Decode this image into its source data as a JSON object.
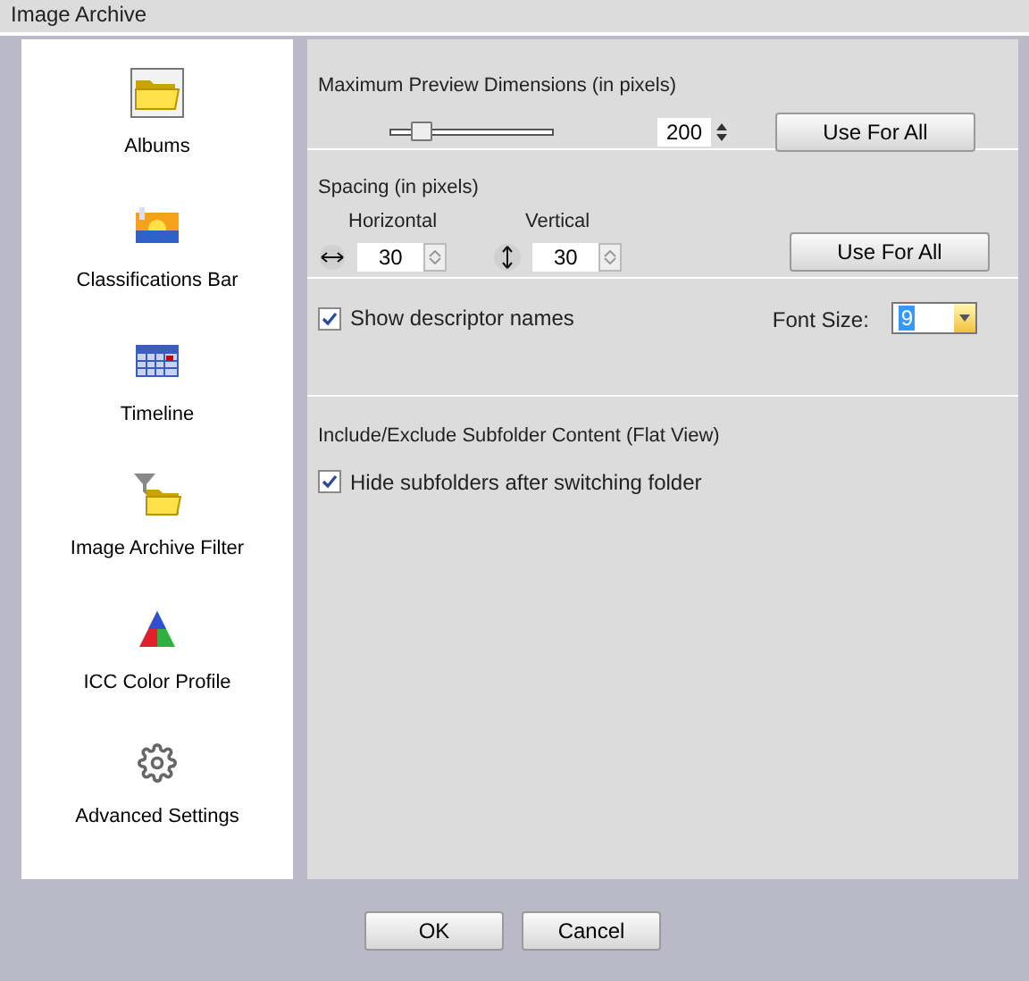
{
  "window": {
    "title": "Image Archive"
  },
  "sidebar": {
    "items": [
      {
        "label": "Albums",
        "kind": "folder",
        "selected": true
      },
      {
        "label": "Classifications Bar",
        "kind": "landscape",
        "selected": false
      },
      {
        "label": "Timeline",
        "kind": "calendar",
        "selected": false
      },
      {
        "label": "Image Archive Filter",
        "kind": "filter",
        "selected": false
      },
      {
        "label": "ICC Color Profile",
        "kind": "color",
        "selected": false
      },
      {
        "label": "Advanced Settings",
        "kind": "gear",
        "selected": false
      }
    ]
  },
  "preview": {
    "title": "Maximum Preview Dimensions (in pixels)",
    "slider": {
      "level": 0.2
    },
    "value": "200",
    "button": "Use For All"
  },
  "spacing": {
    "title": "Spacing (in pixels)",
    "horizontal": {
      "label": "Horizontal",
      "value": "30"
    },
    "vertical": {
      "label": "Vertical",
      "value": "30"
    },
    "button": "Use For All"
  },
  "descriptor": {
    "checkbox": {
      "label": "Show descriptor names",
      "checked": true
    },
    "font_size": {
      "label": "Font Size:",
      "value": "9"
    }
  },
  "subfolder": {
    "title": "Include/Exclude Subfolder Content (Flat View)",
    "checkbox": {
      "label": "Hide subfolders after switching folder",
      "checked": true
    }
  },
  "buttons": [
    "OK",
    "Cancel"
  ]
}
